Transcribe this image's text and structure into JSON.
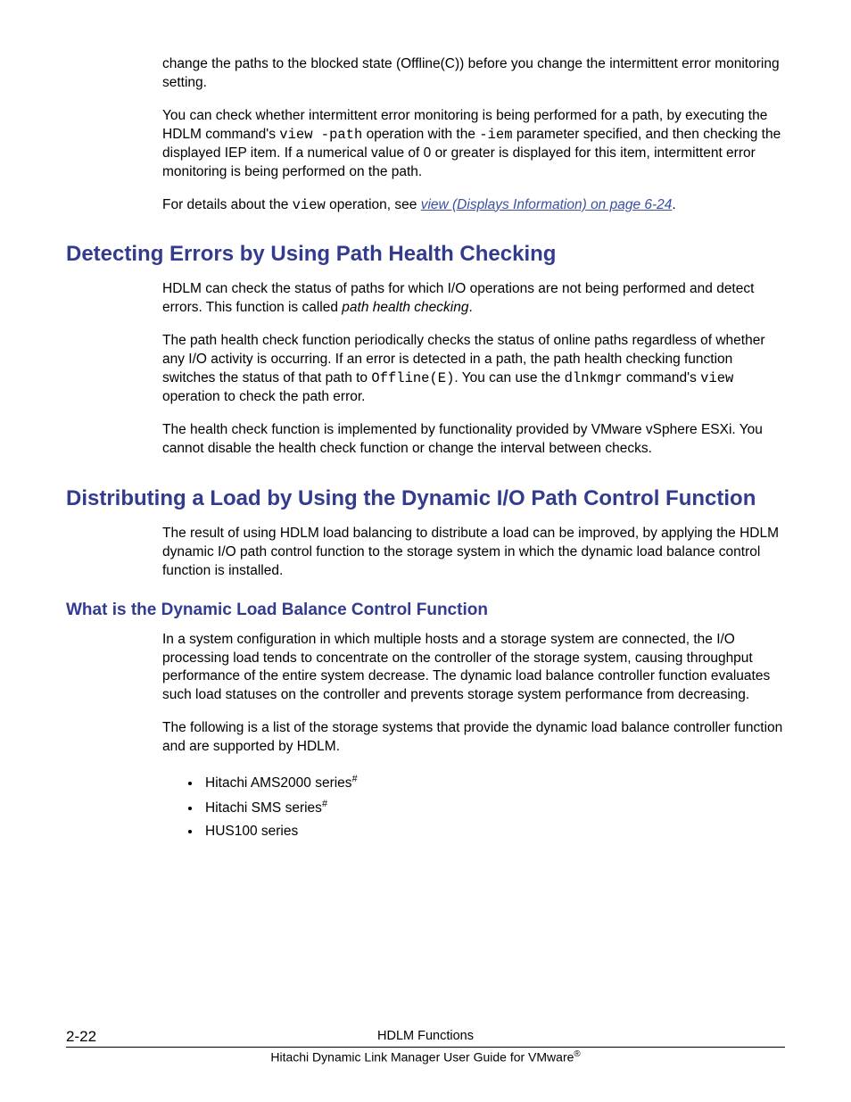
{
  "para1": "change the paths to the blocked state (Offline(C)) before you change the intermittent error monitoring setting.",
  "para2_a": "You can check whether intermittent error monitoring is being performed for a path, by executing the HDLM command's ",
  "para2_code1": "view -path",
  "para2_b": " operation with the ",
  "para2_code2": "-iem",
  "para2_c": " parameter specified, and then checking the displayed IEP item. If a numerical value of 0 or greater is displayed for this item, intermittent error monitoring is being performed on the path.",
  "para3_a": "For details about the ",
  "para3_code": "view",
  "para3_b": " operation, see ",
  "para3_link": "view (Displays Information) on page 6-24",
  "para3_c": ".",
  "h1a": "Detecting Errors by Using Path Health Checking",
  "para4_a": "HDLM can check the status of paths for which I/O operations are not being performed and detect errors. This function is called ",
  "para4_i": "path health checking",
  "para4_b": ".",
  "para5_a": "The path health check function periodically checks the status of online paths regardless of whether any I/O activity is occurring. If an error is detected in a path, the path health checking function switches the status of that path to ",
  "para5_code1": "Offline(E)",
  "para5_b": ". You can use the ",
  "para5_code2": "dlnkmgr",
  "para5_c": " command's ",
  "para5_code3": "view",
  "para5_d": " operation to check the path error.",
  "para6": "The health check function is implemented by functionality provided by VMware vSphere ESXi. You cannot disable the health check function or change the interval between checks.",
  "h1b": "Distributing a Load by Using the Dynamic I/O Path Control Function",
  "para7": "The result of using HDLM load balancing to distribute a load can be improved, by applying the HDLM dynamic I/O path control function to the storage system in which the dynamic load balance control function is installed.",
  "h2a": "What is the Dynamic Load Balance Control Function",
  "para8": "In a system configuration in which multiple hosts and a storage system are connected, the I/O processing load tends to concentrate on the controller of the storage system, causing throughput performance of the entire system decrease. The dynamic load balance controller function evaluates such load statuses on the controller and prevents storage system performance from decreasing.",
  "para9": "The following is a list of the storage systems that provide the dynamic load balance controller function and are supported by HDLM.",
  "li1_a": "Hitachi AMS2000 series",
  "li1_sup": "#",
  "li2_a": "Hitachi SMS series",
  "li2_sup": "#",
  "li3": "HUS100 series",
  "footer_page": "2-22",
  "footer_title": "HDLM Functions",
  "footer_sub_a": "Hitachi Dynamic Link Manager User Guide for VMware",
  "footer_sub_sup": "®"
}
